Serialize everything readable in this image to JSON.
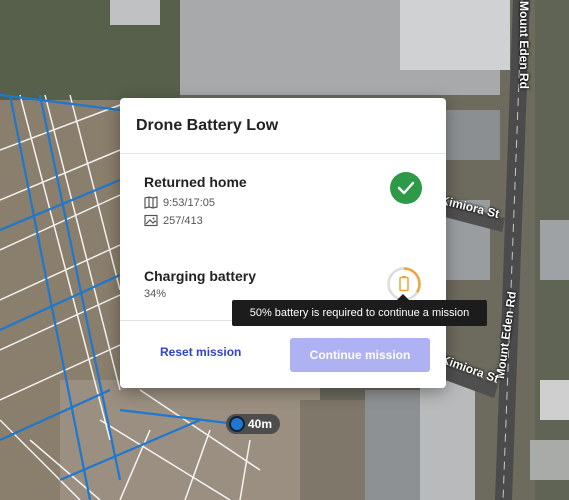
{
  "map": {
    "streets": [
      "Mount Eden Rd",
      "Mount Eden Rd",
      "Kimiora St",
      "Kimiora St"
    ],
    "scale_label": "40m",
    "colors": {
      "flight_path": "#1f77ce",
      "grid": "#ffffff"
    }
  },
  "dialog": {
    "title": "Drone Battery Low",
    "steps": [
      {
        "title": "Returned home",
        "icon": "check-icon",
        "status_color": "#2e9a48",
        "meta": [
          {
            "icon": "map-icon",
            "value": "9:53/17:05"
          },
          {
            "icon": "image-icon",
            "value": "257/413"
          }
        ]
      },
      {
        "title": "Charging battery",
        "icon": "battery-icon",
        "status_color": "#f0a33a",
        "value": "34%",
        "progress": 0.34
      }
    ],
    "buttons": {
      "reset": "Reset mission",
      "continue": "Continue mission"
    },
    "tooltip": "50% battery is required to continue a mission"
  },
  "colors": {
    "primary": "#2f45c8",
    "primary_disabled": "#aeb2f3",
    "success": "#2e9a48",
    "warning": "#f0a33a"
  }
}
